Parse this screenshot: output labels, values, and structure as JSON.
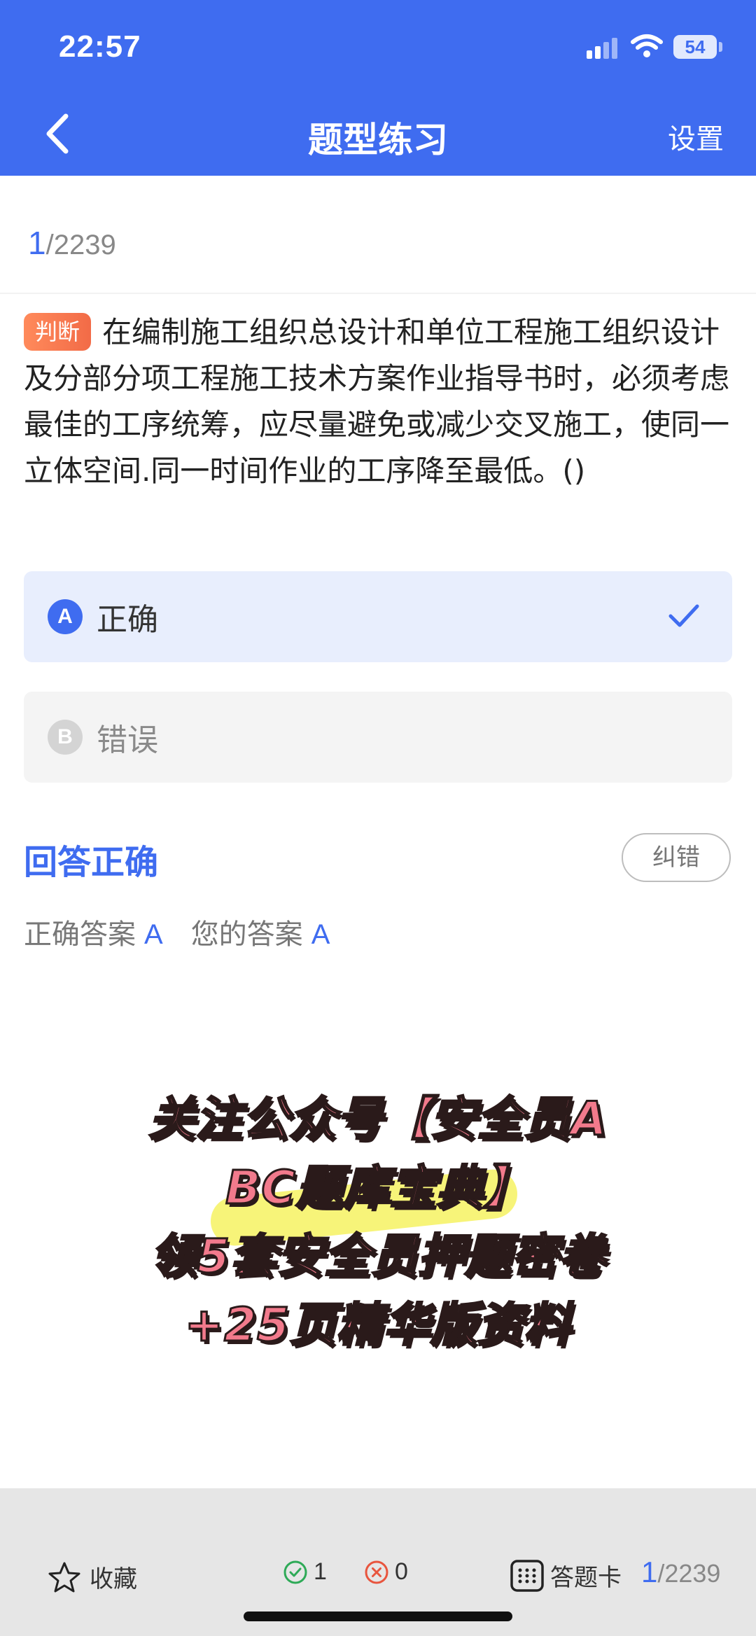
{
  "status_bar": {
    "time": "22:57",
    "battery": "54"
  },
  "header": {
    "title": "题型练习",
    "settings_label": "设置"
  },
  "counter": {
    "current": "1",
    "total": "/2239"
  },
  "question": {
    "type_badge": "判断",
    "text": "在编制施工组织总设计和单位工程施工组织设计及分部分项工程施工技术方案作业指导书时，必须考虑最佳的工序统筹，应尽量避免或减少交叉施工，使同一立体空间.同一时间作业的工序降至最低。()"
  },
  "options": [
    {
      "letter": "A",
      "text": "正确",
      "selected": true
    },
    {
      "letter": "B",
      "text": "错误",
      "selected": false
    }
  ],
  "result": {
    "title": "回答正确",
    "report_label": "纠错",
    "correct_label": "正确答案",
    "correct_value": "A",
    "yours_label": "您的答案",
    "yours_value": "A"
  },
  "promo": {
    "line1": "关注公众号【安全员A",
    "line2": "BC题库宝典】",
    "line3": "领5套安全员押题密卷",
    "line4": "+25页精华版资料"
  },
  "bottom_bar": {
    "favorite_label": "收藏",
    "correct_count": "1",
    "wrong_count": "0",
    "card_label": "答题卡",
    "current": "1",
    "total": "/2239"
  },
  "colors": {
    "accent": "#3F6CF0",
    "badge": "#F26B47",
    "correct": "#2EAA57",
    "wrong": "#E8553E"
  }
}
